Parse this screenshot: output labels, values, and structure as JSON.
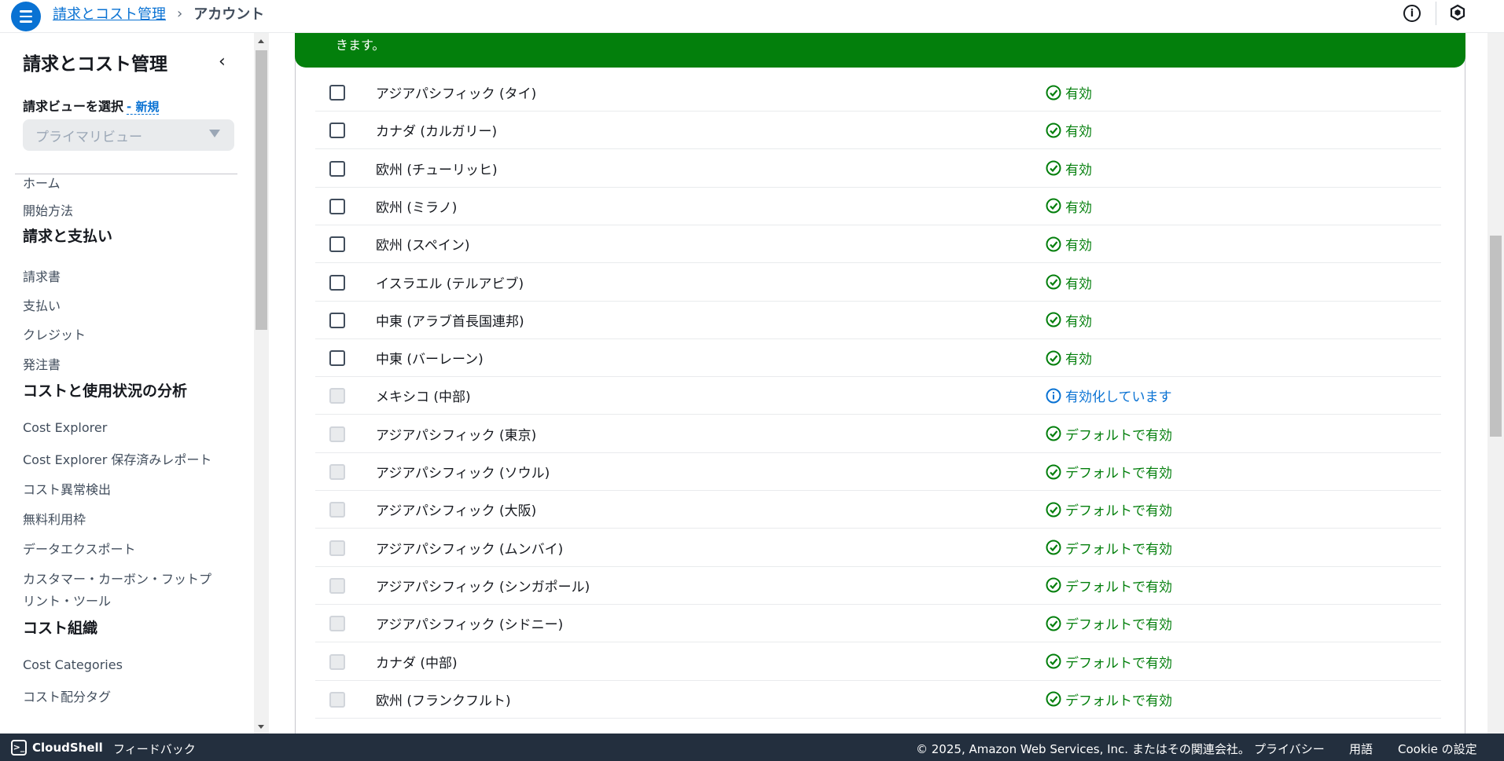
{
  "header": {
    "breadcrumb_root": "請求とコスト管理",
    "breadcrumb_current": "アカウント"
  },
  "sidebar": {
    "title": "請求とコスト管理",
    "view_label": "請求ビューを選択",
    "view_new": "- 新規",
    "view_select_placeholder": "プライマリビュー",
    "nav": [
      {
        "type": "item",
        "label": "ホーム"
      },
      {
        "type": "item",
        "label": "開始方法"
      },
      {
        "type": "section",
        "label": "請求と支払い"
      },
      {
        "type": "item",
        "label": "請求書"
      },
      {
        "type": "item",
        "label": "支払い"
      },
      {
        "type": "item",
        "label": "クレジット"
      },
      {
        "type": "item",
        "label": "発注書"
      },
      {
        "type": "section",
        "label": "コストと使用状況の分析"
      },
      {
        "type": "item",
        "label": "Cost Explorer"
      },
      {
        "type": "item",
        "label": "Cost Explorer 保存済みレポート"
      },
      {
        "type": "item",
        "label": "コスト異常検出"
      },
      {
        "type": "item",
        "label": "無料利用枠"
      },
      {
        "type": "item",
        "label": "データエクスポート"
      },
      {
        "type": "item",
        "label": "カスタマー・カーボン・フットプ"
      },
      {
        "type": "item",
        "label": "リント・ツール"
      },
      {
        "type": "section",
        "label": "コスト組織"
      },
      {
        "type": "item",
        "label": "Cost Categories"
      },
      {
        "type": "item",
        "label": "コスト配分タグ"
      }
    ]
  },
  "flash": {
    "text": "きます。"
  },
  "regions": [
    {
      "name": "アジアパシフィック (タイ)",
      "status": "有効",
      "kind": "enabled",
      "selectable": true
    },
    {
      "name": "カナダ (カルガリー)",
      "status": "有効",
      "kind": "enabled",
      "selectable": true
    },
    {
      "name": "欧州 (チューリッヒ)",
      "status": "有効",
      "kind": "enabled",
      "selectable": true
    },
    {
      "name": "欧州 (ミラノ)",
      "status": "有効",
      "kind": "enabled",
      "selectable": true
    },
    {
      "name": "欧州 (スペイン)",
      "status": "有効",
      "kind": "enabled",
      "selectable": true
    },
    {
      "name": "イスラエル (テルアビブ)",
      "status": "有効",
      "kind": "enabled",
      "selectable": true
    },
    {
      "name": "中東 (アラブ首長国連邦)",
      "status": "有効",
      "kind": "enabled",
      "selectable": true
    },
    {
      "name": "中東 (バーレーン)",
      "status": "有効",
      "kind": "enabled",
      "selectable": true
    },
    {
      "name": "メキシコ (中部)",
      "status": "有効化しています",
      "kind": "enabling",
      "selectable": false
    },
    {
      "name": "アジアパシフィック (東京)",
      "status": "デフォルトで有効",
      "kind": "default",
      "selectable": false
    },
    {
      "name": "アジアパシフィック (ソウル)",
      "status": "デフォルトで有効",
      "kind": "default",
      "selectable": false
    },
    {
      "name": "アジアパシフィック (大阪)",
      "status": "デフォルトで有効",
      "kind": "default",
      "selectable": false
    },
    {
      "name": "アジアパシフィック (ムンバイ)",
      "status": "デフォルトで有効",
      "kind": "default",
      "selectable": false
    },
    {
      "name": "アジアパシフィック (シンガポール)",
      "status": "デフォルトで有効",
      "kind": "default",
      "selectable": false
    },
    {
      "name": "アジアパシフィック (シドニー)",
      "status": "デフォルトで有効",
      "kind": "default",
      "selectable": false
    },
    {
      "name": "カナダ (中部)",
      "status": "デフォルトで有効",
      "kind": "default",
      "selectable": false
    },
    {
      "name": "欧州 (フランクフルト)",
      "status": "デフォルトで有効",
      "kind": "default",
      "selectable": false
    }
  ],
  "footer": {
    "cloudshell": "CloudShell",
    "feedback": "フィードバック",
    "copyright": "© 2025, Amazon Web Services, Inc. またはその関連会社。",
    "privacy": "プライバシー",
    "terms": "用語",
    "cookie": "Cookie の設定"
  },
  "colors": {
    "primary": "#0972d3",
    "success": "#037f0c",
    "footer_bg": "#232f3e"
  }
}
